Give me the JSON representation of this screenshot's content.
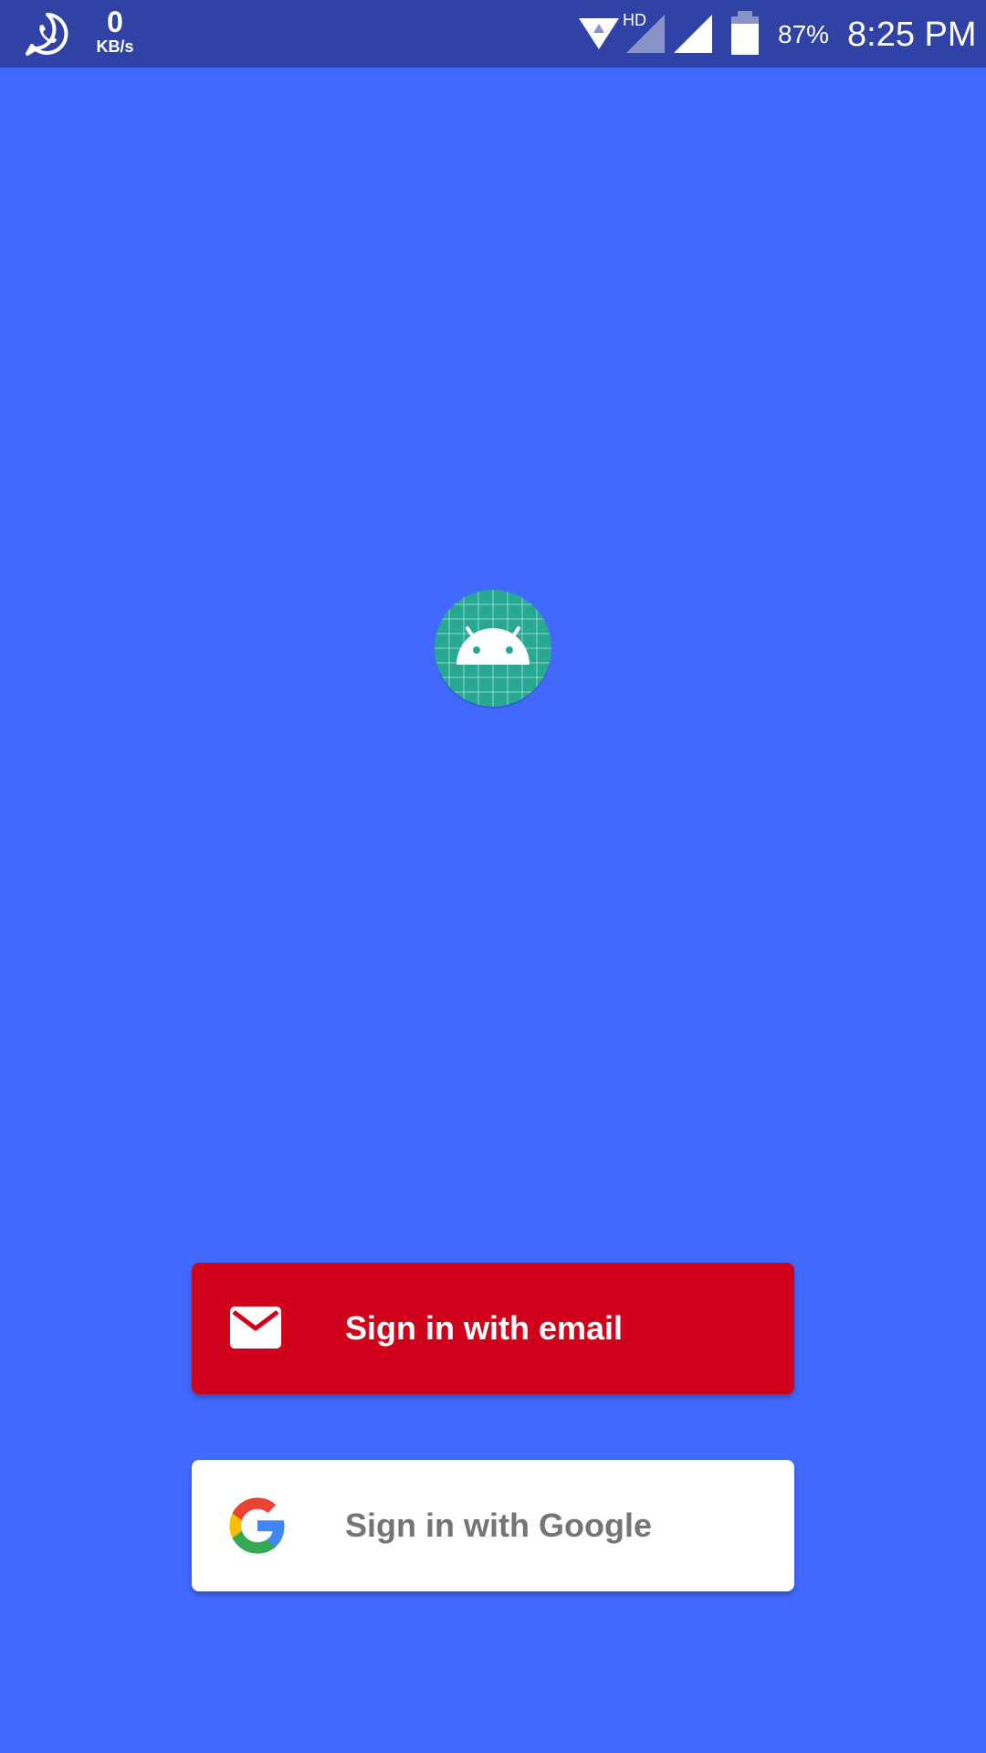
{
  "status_bar": {
    "net_speed_value": "0",
    "net_speed_unit": "KB/s",
    "network_type": "HD",
    "battery_percent": "87%",
    "time": "8:25 PM",
    "icons": [
      "whatsapp-icon",
      "wifi-icon",
      "signal-hd-icon",
      "signal-icon",
      "battery-icon"
    ]
  },
  "main": {
    "logo_icon": "android-app-icon"
  },
  "buttons": {
    "email": {
      "label": "Sign in with email",
      "icon": "email-icon",
      "color": "#d0021b"
    },
    "google": {
      "label": "Sign in with Google",
      "icon": "google-icon",
      "color": "#ffffff"
    }
  },
  "colors": {
    "background": "#4169fe",
    "status_bar": "#3142a6"
  }
}
